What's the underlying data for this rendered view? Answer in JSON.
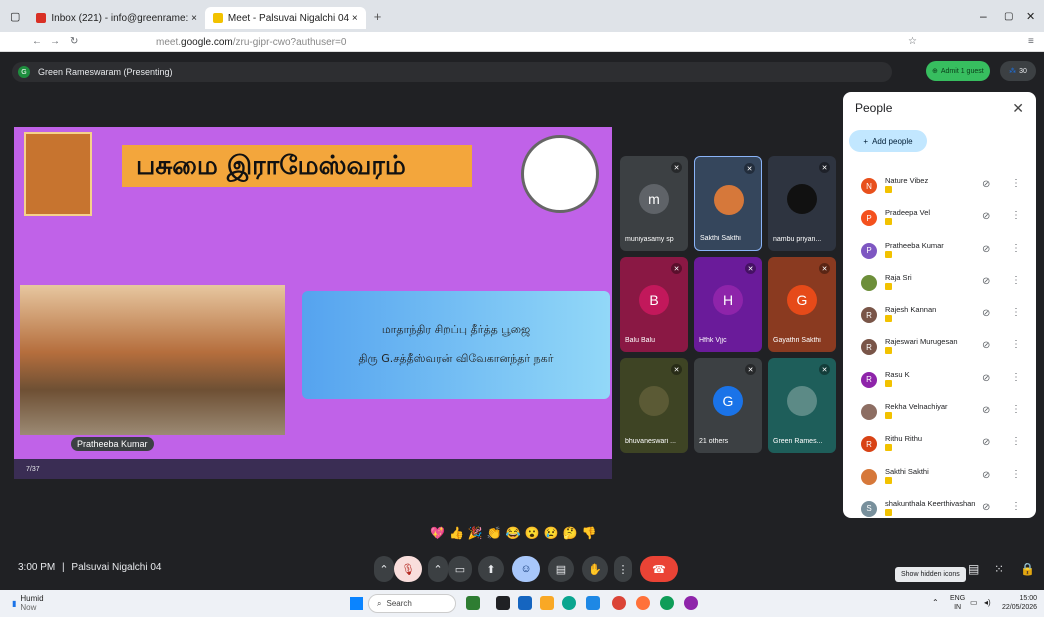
{
  "tabs": [
    {
      "label": "Inbox (221) - info@greenrame: ×",
      "fav_color": "#d93025"
    },
    {
      "label": "Meet - Palsuvai Nigalchi 04 ×",
      "fav_color": "#f2c200"
    }
  ],
  "address": {
    "prefix": "meet.",
    "domain": "google.com",
    "path": "/zru-gipr-cwo?authuser=0"
  },
  "meeting": {
    "presenter_banner": "Green Rameswaram (Presenting)",
    "admit_label": "Admit 1 guest",
    "participant_count": "30",
    "time": "3:00 PM",
    "separator": "|",
    "title": "Palsuvai Nigalchi 04"
  },
  "slide": {
    "title": "பசுமை இராமேஸ்வரம்",
    "line1": "மாதாந்திர சிறப்பு தீர்த்த பூஜை",
    "line2": "திரு G.சத்தீஸ்வரன் விவேகானந்தர் நகர்",
    "speaker_chip": "Pratheeba Kumar",
    "page": "7/37"
  },
  "tiles": [
    {
      "name": "muniyasamy sp",
      "initial": "m",
      "bg": "#3c4043",
      "av": "#5f6368"
    },
    {
      "name": "Sakthi Sakthi",
      "initial": "",
      "bg": "#35465c",
      "av": "#d6783a"
    },
    {
      "name": "nambu priyan...",
      "initial": "",
      "bg": "#2e3440",
      "av": "#111"
    },
    {
      "name": "Balu Balu",
      "initial": "B",
      "bg": "#8a1844",
      "av": "#c2185b"
    },
    {
      "name": "Hfhk Vjjc",
      "initial": "H",
      "bg": "#6a1b9a",
      "av": "#8e24aa"
    },
    {
      "name": "Gayathri Sakthi",
      "initial": "G",
      "bg": "#8a3a20",
      "av": "#e64a19"
    },
    {
      "name": "bhuvaneswari ...",
      "initial": "",
      "bg": "#3e4424",
      "av": "#5b5a35"
    },
    {
      "name": "21 others",
      "initial": "G",
      "bg": "#3c4043",
      "av": "#1a73e8"
    },
    {
      "name": "Green Rames...",
      "initial": "",
      "bg": "#1e5e5a",
      "av": "#5c8a86"
    }
  ],
  "people_panel": {
    "title": "People",
    "add_label": "Add people",
    "people": [
      {
        "name": "Nature Vibez",
        "initial": "N",
        "color": "#e8501c"
      },
      {
        "name": "Pradeepa Vel",
        "initial": "P",
        "color": "#f4511e"
      },
      {
        "name": "Pratheeba Kumar",
        "initial": "P",
        "color": "#7e57c2"
      },
      {
        "name": "Raja Sri",
        "initial": "",
        "color": "#6d8f3a"
      },
      {
        "name": "Rajesh Kannan",
        "initial": "R",
        "color": "#795548"
      },
      {
        "name": "Rajeswari Murugesan",
        "initial": "R",
        "color": "#795548"
      },
      {
        "name": "Rasu K",
        "initial": "R",
        "color": "#8e24aa"
      },
      {
        "name": "Rekha Velnachiyar",
        "initial": "",
        "color": "#8d6e63"
      },
      {
        "name": "Rithu Rithu",
        "initial": "R",
        "color": "#d84315"
      },
      {
        "name": "Sakthi Sakthi",
        "initial": "",
        "color": "#d6783a"
      },
      {
        "name": "shakunthala Keerthivashan",
        "initial": "S",
        "color": "#78909c"
      }
    ]
  },
  "tooltip": "Show hidden icons",
  "taskbar": {
    "weather": "Humid",
    "weather_sub": "Now",
    "search": "Search",
    "lang1": "ENG",
    "lang2": "IN",
    "clock_time": "15:00",
    "clock_date": "22/05/2026"
  }
}
